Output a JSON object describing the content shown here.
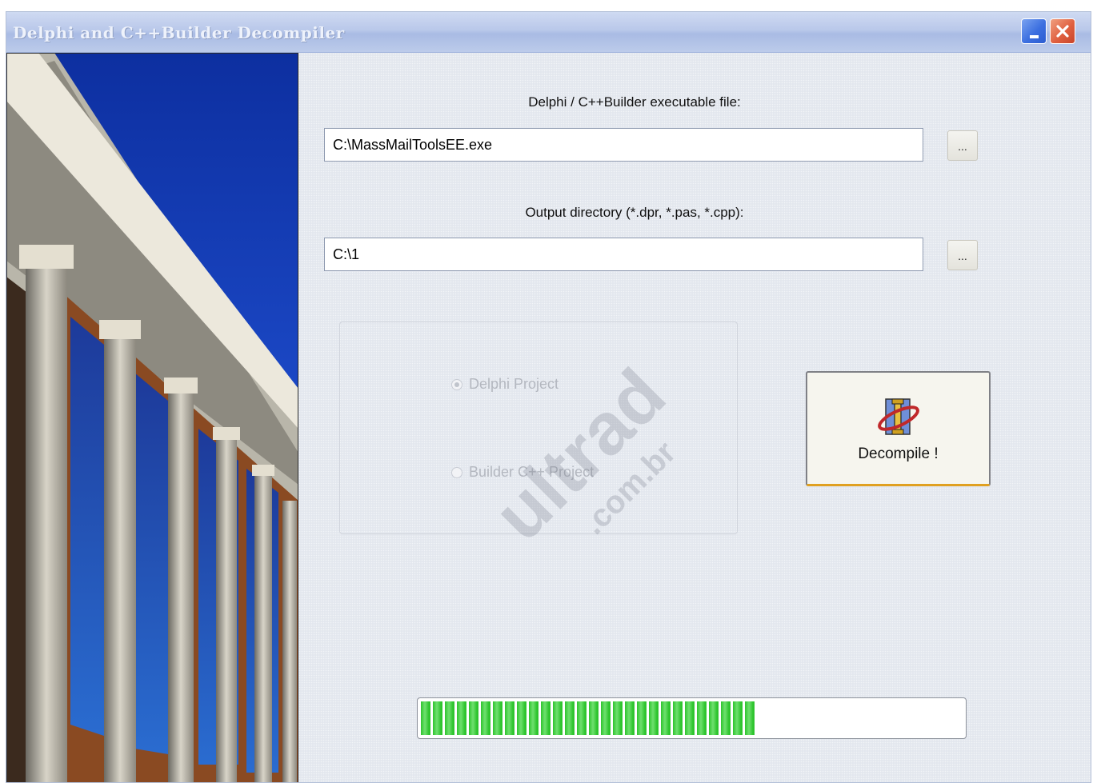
{
  "window": {
    "title": "Delphi and C++Builder Decompiler"
  },
  "form": {
    "exe_label": "Delphi / C++Builder executable file:",
    "exe_value": "C:\\MassMailToolsEE.exe",
    "browse_exe_label": "...",
    "output_label": "Output directory (*.dpr, *.pas, *.cpp):",
    "output_value": "C:\\1",
    "browse_output_label": "...",
    "project_type": {
      "options": [
        "Delphi Project",
        "Builder C++ Project"
      ],
      "selected": "Delphi Project"
    },
    "decompile_label": "Decompile !"
  },
  "progress": {
    "value_fraction": 0.62
  },
  "watermark": {
    "line1": "ultrad",
    "line2": ".com.br"
  },
  "colors": {
    "progress_fill": "#2ec42e",
    "decompile_accent": "#e0a020",
    "titlebar": "#b9c8ea"
  }
}
